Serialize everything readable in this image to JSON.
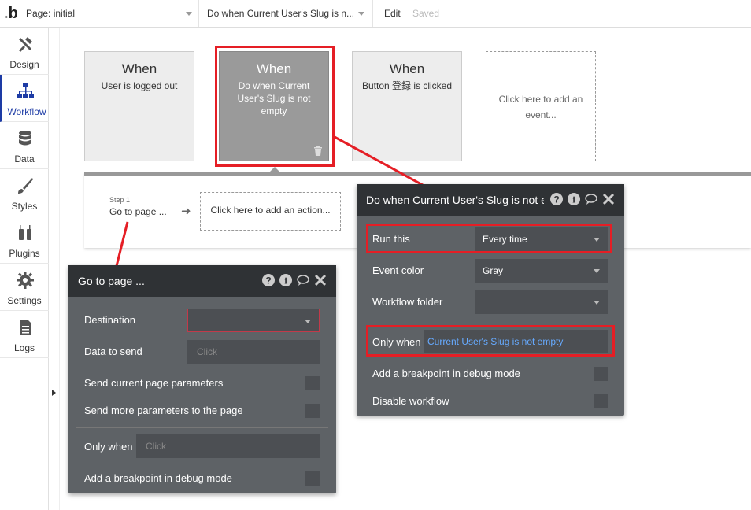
{
  "topbar": {
    "logo": "b",
    "page_label": "Page: initial",
    "workflow_label": "Do when Current User's Slug is n...",
    "edit_label": "Edit",
    "saved_label": "Saved"
  },
  "sidebar": {
    "items": [
      {
        "label": "Design",
        "icon": "design-icon"
      },
      {
        "label": "Workflow",
        "icon": "workflow-icon",
        "active": true
      },
      {
        "label": "Data",
        "icon": "data-icon"
      },
      {
        "label": "Styles",
        "icon": "styles-icon"
      },
      {
        "label": "Plugins",
        "icon": "plugins-icon"
      },
      {
        "label": "Settings",
        "icon": "settings-icon"
      },
      {
        "label": "Logs",
        "icon": "logs-icon"
      }
    ]
  },
  "events": [
    {
      "when": "When",
      "desc": "User is logged out"
    },
    {
      "when": "When",
      "desc": "Do when Current User's Slug is not empty",
      "selected": true
    },
    {
      "when": "When",
      "desc": "Button 登録 is clicked"
    },
    {
      "when": "",
      "desc": "Click here to add an event..."
    }
  ],
  "actions": {
    "step_number": "Step 1",
    "step_name": "Go to page ...",
    "add_action": "Click here to add an action..."
  },
  "workflow_panel": {
    "title": "Do when Current User's Slug is not empty",
    "run_this_label": "Run this",
    "run_this_value": "Every time",
    "event_color_label": "Event color",
    "event_color_value": "Gray",
    "folder_label": "Workflow folder",
    "folder_value": "",
    "only_when_label": "Only when",
    "only_when_value": "Current User's Slug is not empty",
    "breakpoint_label": "Add a breakpoint in debug mode",
    "disable_label": "Disable workflow"
  },
  "action_panel": {
    "title": "Go to page ...",
    "destination_label": "Destination",
    "data_to_send_label": "Data to send",
    "data_to_send_placeholder": "Click",
    "send_current_label": "Send current page parameters",
    "send_more_label": "Send more parameters to the page",
    "only_when_label": "Only when",
    "only_when_placeholder": "Click",
    "breakpoint_label": "Add a breakpoint in debug mode"
  },
  "colors": {
    "annotation_red": "#e51e25",
    "panel_bg": "#5e6266",
    "panel_header": "#2f3235",
    "accent_blue": "#1d3ba5",
    "link_blue": "#66aaff"
  }
}
